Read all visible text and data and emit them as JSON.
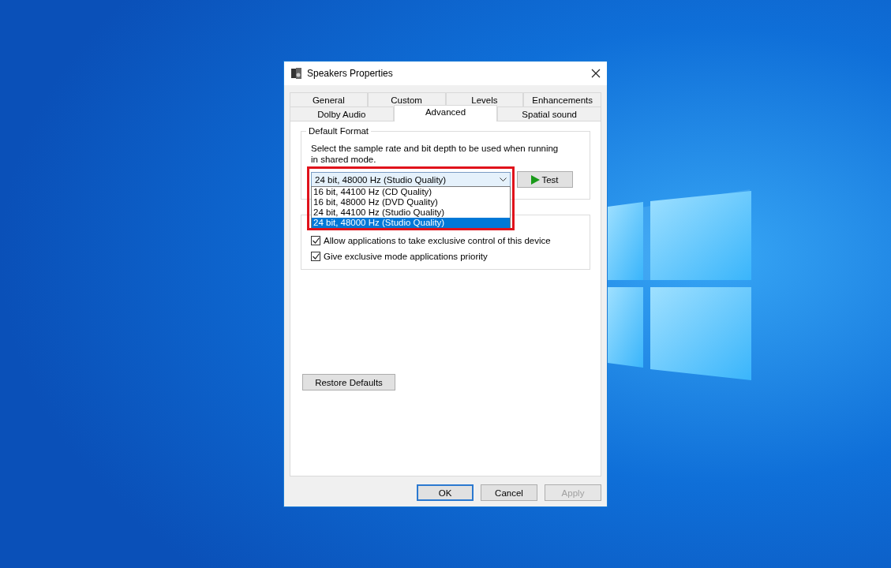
{
  "window": {
    "title": "Speakers Properties"
  },
  "tab_rows": [
    [
      {
        "label": "General",
        "selected": false
      },
      {
        "label": "Custom",
        "selected": false
      },
      {
        "label": "Levels",
        "selected": false
      },
      {
        "label": "Enhancements",
        "selected": false
      }
    ],
    [
      {
        "label": "Dolby Audio",
        "selected": false
      },
      {
        "label": "Advanced",
        "selected": true
      },
      {
        "label": "Spatial sound",
        "selected": false
      }
    ]
  ],
  "default_format": {
    "title": "Default Format",
    "description": "Select the sample rate and bit depth to be used when running in shared mode.",
    "highlighted": true,
    "dropdown": {
      "value": "24 bit, 48000 Hz (Studio Quality)",
      "expanded": true,
      "options": [
        {
          "label": "16 bit, 44100 Hz (CD Quality)",
          "selected": false
        },
        {
          "label": "16 bit, 48000 Hz (DVD Quality)",
          "selected": false
        },
        {
          "label": "24 bit, 44100 Hz (Studio Quality)",
          "selected": false
        },
        {
          "label": "24 bit, 48000 Hz (Studio Quality)",
          "selected": true
        }
      ]
    },
    "test_button": "Test"
  },
  "exclusive_mode": {
    "options": [
      {
        "label": "Allow applications to take exclusive control of this device",
        "checked": true
      },
      {
        "label": "Give exclusive mode applications priority",
        "checked": true
      }
    ]
  },
  "restore_defaults": "Restore Defaults",
  "buttons": [
    {
      "label": "OK",
      "default": true,
      "disabled": false
    },
    {
      "label": "Cancel",
      "default": false,
      "disabled": false
    },
    {
      "label": "Apply",
      "default": false,
      "disabled": true
    }
  ]
}
